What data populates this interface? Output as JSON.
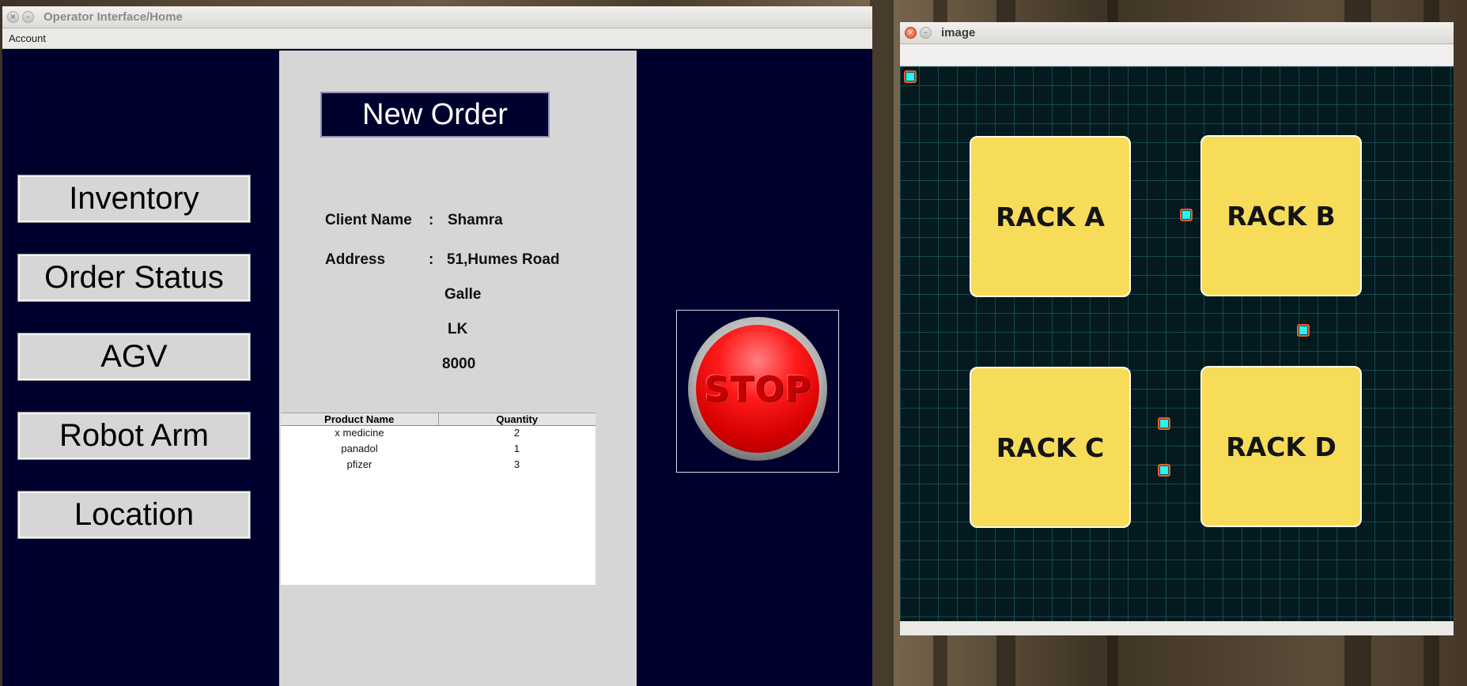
{
  "operator_window": {
    "title": "Operator Interface/Home",
    "menu": {
      "account": "Account"
    },
    "nav": [
      "Inventory",
      "Order Status",
      "AGV",
      "Robot Arm",
      "Location"
    ],
    "order": {
      "heading": "New Order",
      "client_label": "Client Name",
      "client_value": "Shamra",
      "address_label": "Address",
      "colon": ":",
      "address_lines": [
        "51,Humes Road",
        "Galle",
        "LK",
        "8000"
      ]
    },
    "table": {
      "headers": [
        "Product Name",
        "Quantity"
      ],
      "rows": [
        [
          "x medicine",
          "2"
        ],
        [
          "panadol",
          "1"
        ],
        [
          "pfizer",
          "3"
        ]
      ]
    },
    "stop_label": "STOP"
  },
  "map_window": {
    "title": "image",
    "racks": [
      "RACK A",
      "RACK B",
      "RACK C",
      "RACK D"
    ],
    "colors": {
      "rack": "#f7dc5a",
      "grid_bg": "#041a1e",
      "agv": "#2ef0f0",
      "agv_border": "#f15a24",
      "panel_bg": "#00002e"
    }
  }
}
